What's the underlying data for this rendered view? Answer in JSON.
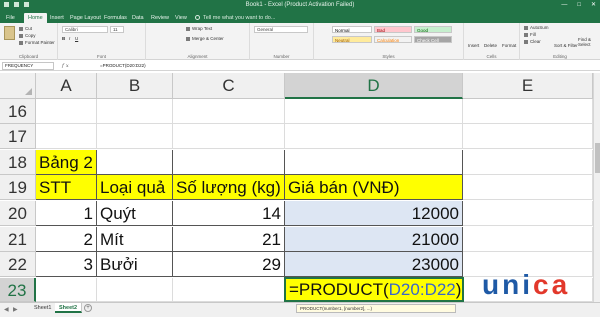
{
  "app": {
    "window_title": "Book1 - Excel (Product Activation Failed)",
    "window_controls": [
      "—",
      "□",
      "✕"
    ]
  },
  "ribbon_tabs": [
    "File",
    "Home",
    "Insert",
    "Page Layout",
    "Formulas",
    "Data",
    "Review",
    "View"
  ],
  "active_tab": "Home",
  "tell_me": "Tell me what you want to do...",
  "ribbon": {
    "clipboard": {
      "label": "Clipboard",
      "cut": "Cut",
      "copy": "Copy",
      "format_painter": "Format Painter"
    },
    "font": {
      "label": "Font",
      "font_name": "Calibri",
      "font_size": "11"
    },
    "alignment": {
      "label": "Alignment",
      "wrap_text": "Wrap Text",
      "merge_center": "Merge & Center"
    },
    "number": {
      "label": "Number",
      "format": "General"
    },
    "styles": {
      "label": "Styles",
      "cells": [
        "Normal",
        "Bad",
        "Good",
        "Neutral",
        "Calculation",
        "Check Cell"
      ]
    },
    "cells": {
      "label": "Cells",
      "insert": "Insert",
      "delete": "Delete",
      "format": "Format"
    },
    "editing": {
      "label": "Editing",
      "autosum": "AutoSum",
      "fill": "Fill",
      "clear": "Clear",
      "sort_filter": "Sort & Filter",
      "find_select": "Find & Select"
    }
  },
  "formula_bar": {
    "name_box": "FREQUENCY",
    "fx": "fx",
    "content": "=PRODUCT(D20:D22)"
  },
  "grid": {
    "columns": [
      "A",
      "B",
      "C",
      "D",
      "E"
    ],
    "rows": [
      "16",
      "17",
      "18",
      "19",
      "20",
      "21",
      "22",
      "23"
    ],
    "cells": {
      "A18": "Bảng 2",
      "A19": "STT",
      "B19": "Loại quả",
      "C19": "Số lượng (kg)",
      "D19": "Giá bán (VNĐ)",
      "A20": "1",
      "B20": "Quýt",
      "C20": "14",
      "D20": "12000",
      "A21": "2",
      "B21": "Mít",
      "C21": "21",
      "D21": "21000",
      "A22": "3",
      "B22": "Bưởi",
      "C22": "29",
      "D22": "23000"
    },
    "editing_cell": {
      "address": "D23",
      "prefix": "=PRODUCT(",
      "ref": "D20:D22",
      "suffix": ")"
    },
    "function_tooltip": "PRODUCT(number1, [number2], ...)"
  },
  "sheets": [
    "Sheet1",
    "Sheet2"
  ],
  "active_sheet": "Sheet2",
  "logo_text": {
    "part1": "uni",
    "part2": "ca"
  },
  "colors": {
    "excel_green": "#217346",
    "highlight_yellow": "#ffff00",
    "range_blue": "#dde6f3"
  }
}
